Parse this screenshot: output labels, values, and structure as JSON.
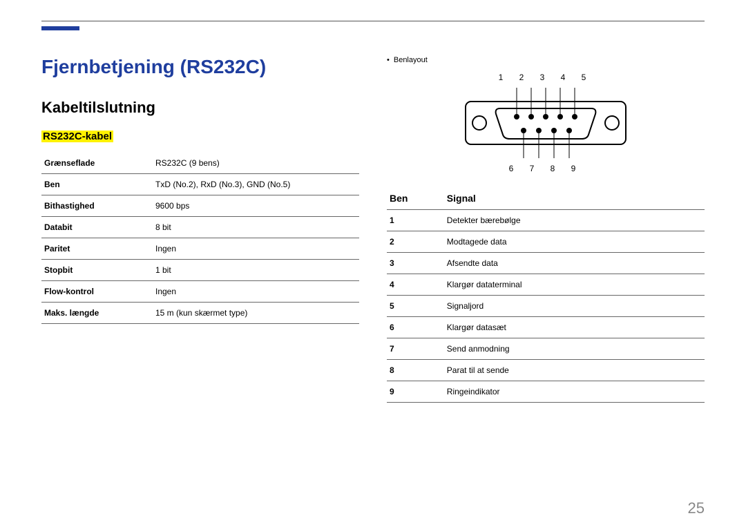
{
  "page": {
    "title": "Fjernbetjening (RS232C)",
    "section": "Kabeltilslutning",
    "highlight": "RS232C-kabel",
    "page_number": "25"
  },
  "spec_rows": [
    {
      "k": "Grænseflade",
      "v": "RS232C (9 bens)"
    },
    {
      "k": "Ben",
      "v": "TxD (No.2), RxD (No.3), GND (No.5)"
    },
    {
      "k": "Bithastighed",
      "v": "9600 bps"
    },
    {
      "k": "Databit",
      "v": "8 bit"
    },
    {
      "k": "Paritet",
      "v": "Ingen"
    },
    {
      "k": "Stopbit",
      "v": "1 bit"
    },
    {
      "k": "Flow-kontrol",
      "v": "Ingen"
    },
    {
      "k": "Maks. længde",
      "v": "15 m (kun skærmet type)"
    }
  ],
  "right": {
    "bullet": "Benlayout",
    "top_nums": "1 2 3 4 5",
    "bottom_nums": "6 7 8 9",
    "header_pin": "Ben",
    "header_signal": "Signal"
  },
  "signals": [
    {
      "pin": "1",
      "name": "Detekter bærebølge"
    },
    {
      "pin": "2",
      "name": "Modtagede data"
    },
    {
      "pin": "3",
      "name": "Afsendte data"
    },
    {
      "pin": "4",
      "name": "Klargør dataterminal"
    },
    {
      "pin": "5",
      "name": "Signaljord"
    },
    {
      "pin": "6",
      "name": "Klargør datasæt"
    },
    {
      "pin": "7",
      "name": "Send anmodning"
    },
    {
      "pin": "8",
      "name": "Parat til at sende"
    },
    {
      "pin": "9",
      "name": "Ringeindikator"
    }
  ]
}
